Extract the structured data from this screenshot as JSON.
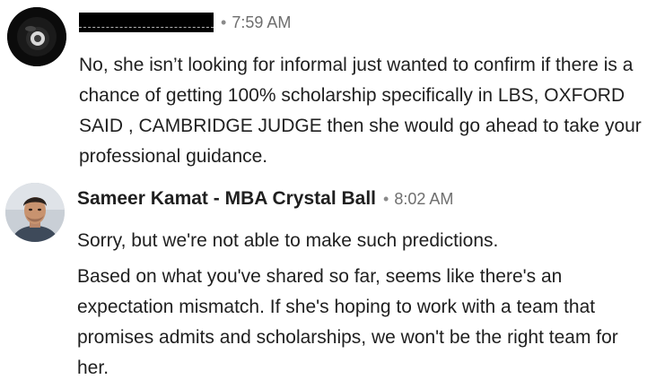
{
  "messages": [
    {
      "sender_redacted": true,
      "time": "7:59 AM",
      "avatar_icon": "dark-circle-avatar",
      "paragraphs": [
        "No, she isn’t looking for informal just wanted to confirm if there is a chance of getting 100% scholarship specifically in LBS, OXFORD SAID , CAMBRIDGE JUDGE then she would go ahead to take your professional guidance."
      ]
    },
    {
      "sender": "Sameer Kamat - MBA Crystal Ball",
      "time": "8:02 AM",
      "avatar_icon": "user-photo-avatar",
      "paragraphs": [
        "Sorry, but we're not able to make such predictions.",
        "Based on what you've shared so far, seems like there's an expectation mismatch. If she's hoping to work with a team that promises admits and scholarships, we won't be the right team for her."
      ]
    }
  ],
  "separator": "•"
}
